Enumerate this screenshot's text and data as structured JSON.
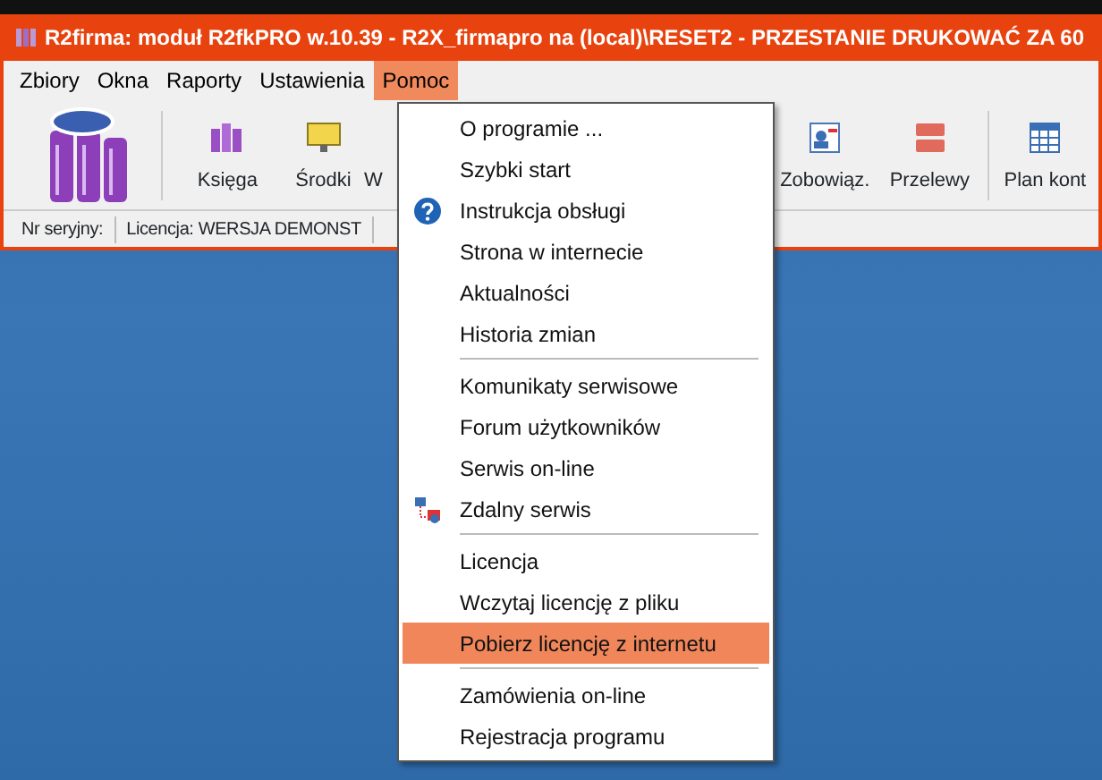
{
  "window": {
    "title": "R2firma: moduł R2fkPRO w.10.39 - R2X_firmapro na (local)\\RESET2 - PRZESTANIE DRUKOWAĆ ZA 60"
  },
  "menu_bar": [
    {
      "label": "Zbiory",
      "selected": false
    },
    {
      "label": "Okna",
      "selected": false
    },
    {
      "label": "Raporty",
      "selected": false
    },
    {
      "label": "Ustawienia",
      "selected": false
    },
    {
      "label": "Pomoc",
      "selected": true
    }
  ],
  "toolbar": [
    {
      "kind": "logo"
    },
    {
      "kind": "button",
      "label": "Księga"
    },
    {
      "kind": "button",
      "label": "Środki"
    },
    {
      "kind": "button",
      "label": "W"
    },
    {
      "kind": "button",
      "label": "Zobowiąz."
    },
    {
      "kind": "button",
      "label": "Przelewy"
    },
    {
      "kind": "button",
      "label": "Plan kont"
    }
  ],
  "status_bar": [
    "Nr seryjny:",
    "Licencja: WERSJA DEMONST"
  ],
  "dropdown": [
    {
      "kind": "item",
      "label": "O programie ...",
      "selected": false
    },
    {
      "kind": "item",
      "label": "Szybki start",
      "selected": false
    },
    {
      "kind": "item",
      "label": "Instrukcja obsługi",
      "selected": false
    },
    {
      "kind": "item",
      "label": "Strona w internecie",
      "selected": false
    },
    {
      "kind": "item",
      "label": "Aktualności",
      "selected": false
    },
    {
      "kind": "item",
      "label": "Historia zmian",
      "selected": false
    },
    {
      "kind": "separator"
    },
    {
      "kind": "item",
      "label": "Komunikaty serwisowe",
      "selected": false
    },
    {
      "kind": "item",
      "label": "Forum użytkowników",
      "selected": false
    },
    {
      "kind": "item",
      "label": "Serwis on-line",
      "selected": false
    },
    {
      "kind": "item",
      "label": "Zdalny serwis",
      "selected": false
    },
    {
      "kind": "separator"
    },
    {
      "kind": "item",
      "label": "Licencja",
      "selected": false
    },
    {
      "kind": "item",
      "label": "Wczytaj licencję z pliku",
      "selected": false
    },
    {
      "kind": "item",
      "label": "Pobierz licencję z internetu",
      "selected": true
    },
    {
      "kind": "separator"
    },
    {
      "kind": "item",
      "label": "Zamówienia on-line",
      "selected": false
    },
    {
      "kind": "item",
      "label": "Rejestracja programu",
      "selected": false
    }
  ]
}
